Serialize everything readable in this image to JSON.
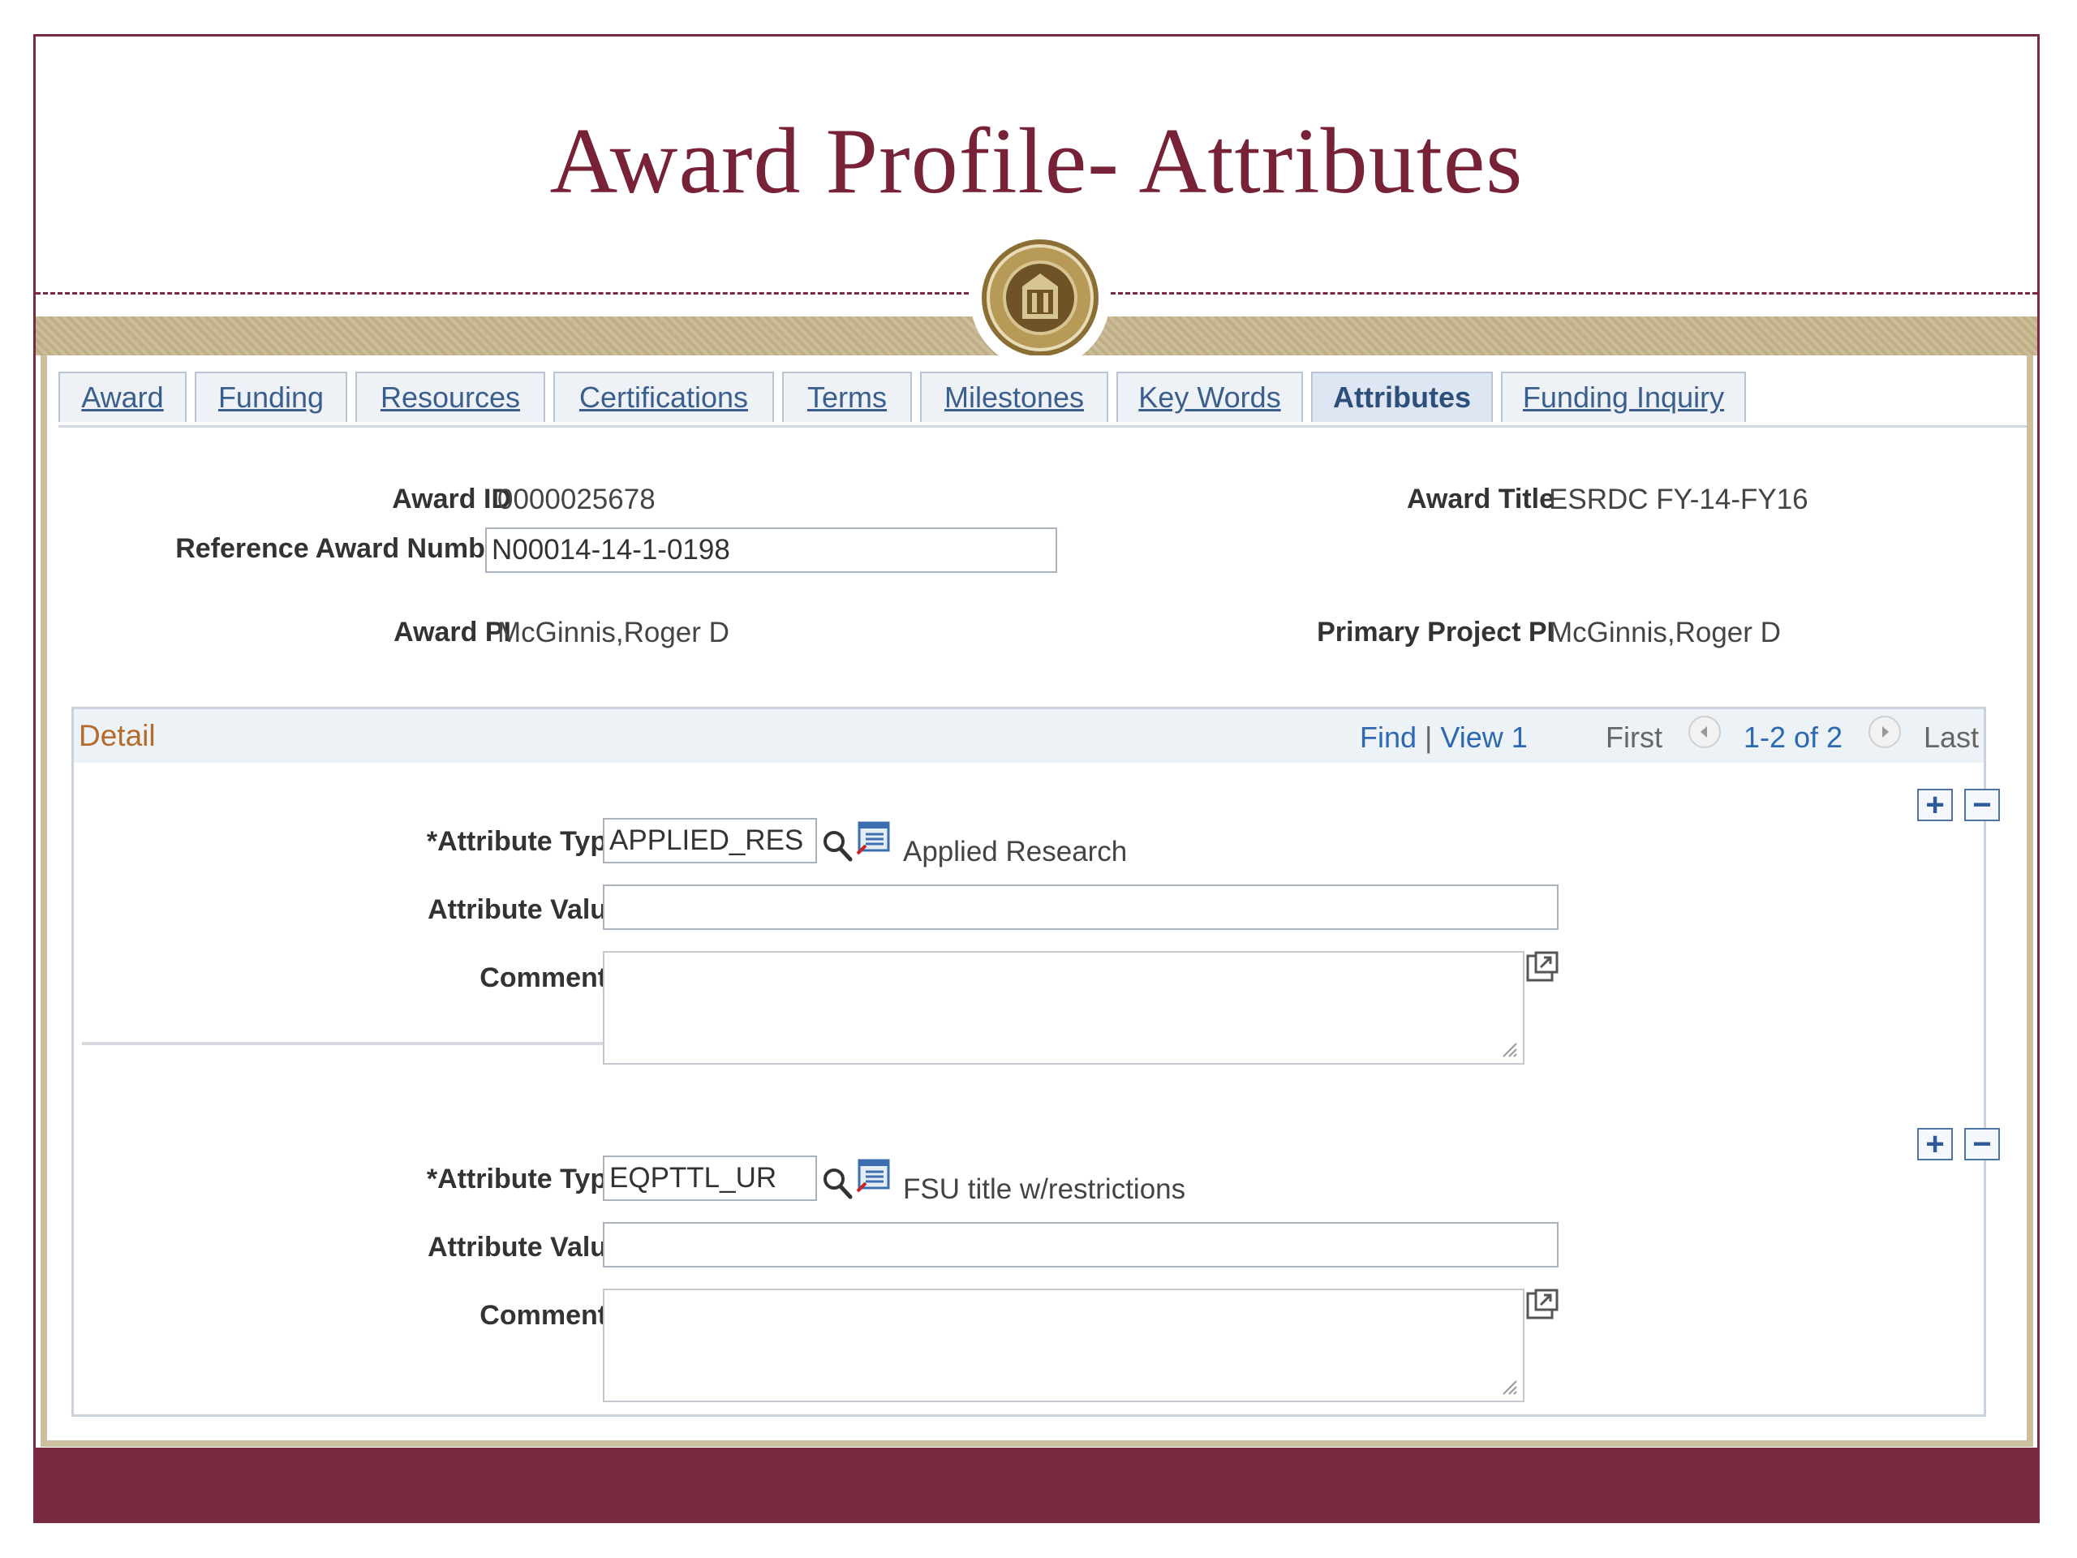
{
  "slide": {
    "title": "Award Profile- Attributes"
  },
  "tabs": [
    {
      "label": "Award",
      "active": false
    },
    {
      "label": "Funding",
      "active": false
    },
    {
      "label": "Resources",
      "active": false
    },
    {
      "label": "Certifications",
      "active": false
    },
    {
      "label": "Terms",
      "active": false
    },
    {
      "label": "Milestones",
      "active": false
    },
    {
      "label": "Key Words",
      "active": false
    },
    {
      "label": "Attributes",
      "active": true
    },
    {
      "label": "Funding Inquiry",
      "active": false
    }
  ],
  "header_fields": {
    "award_id_label": "Award ID",
    "award_id": "0000025678",
    "award_title_label": "Award Title",
    "award_title": "ESRDC FY-14-FY16",
    "reference_award_number_label": "Reference Award Number",
    "reference_award_number": "N00014-14-1-0198",
    "award_pi_label": "Award PI",
    "award_pi": "McGinnis,Roger D",
    "primary_project_pi_label": "Primary Project PI",
    "primary_project_pi": "McGinnis,Roger D"
  },
  "detail": {
    "title": "Detail",
    "find": "Find",
    "separator": "|",
    "view": "View 1",
    "first": "First",
    "range": "1-2 of 2",
    "last": "Last",
    "rows": [
      {
        "attribute_type_label": "*Attribute Type",
        "attribute_type": "APPLIED_RES",
        "attribute_description": "Applied Research",
        "attribute_value_label": "Attribute Value",
        "attribute_value": "",
        "comments_label": "Comments",
        "comments": ""
      },
      {
        "attribute_type_label": "*Attribute Type",
        "attribute_type": "EQPTTL_UR",
        "attribute_description": "FSU title w/restrictions",
        "attribute_value_label": "Attribute Value",
        "attribute_value": "",
        "comments_label": "Comments",
        "comments": ""
      }
    ]
  },
  "icons": {
    "add_row": "+",
    "delete_row": "−",
    "lookup": "magnifier-icon",
    "prompt": "prompt-list-icon",
    "expand": "expand-textarea-icon",
    "prev": "◀",
    "next": "▶"
  },
  "colors": {
    "maroon": "#782237",
    "gold": "#cbbd9a",
    "link": "#2c69b1",
    "detail_title": "#b46b2b"
  }
}
